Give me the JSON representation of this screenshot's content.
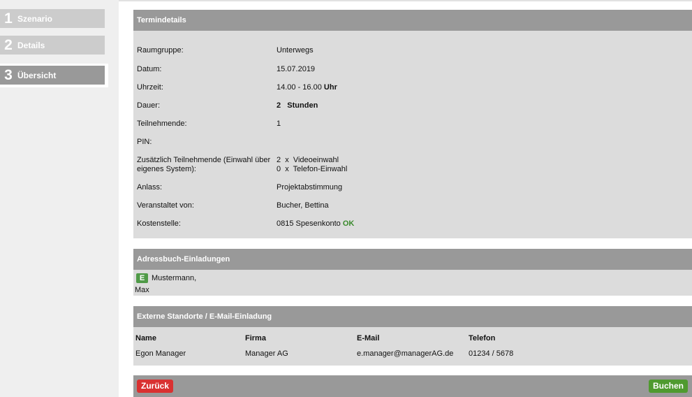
{
  "sidebar": {
    "steps": [
      {
        "num": "1",
        "label": "Szenario"
      },
      {
        "num": "2",
        "label": "Details"
      },
      {
        "num": "3",
        "label": "Übersicht"
      }
    ]
  },
  "termin": {
    "title": "Termindetails",
    "raumgruppe": {
      "label": "Raumgruppe:",
      "value": "Unterwegs"
    },
    "datum": {
      "label": "Datum:",
      "value": "15.07.2019"
    },
    "uhrzeit": {
      "label": "Uhrzeit:",
      "value": "14.00 - 16.00",
      "unit": "Uhr"
    },
    "dauer": {
      "label": "Dauer:",
      "value": "2",
      "unit": "Stunden"
    },
    "teilnehmende": {
      "label": "Teilnehmende:",
      "value": "1"
    },
    "pin": {
      "label": "PIN:",
      "value": ""
    },
    "zusaetzlich": {
      "label_line1": "Zusätzlich Teilnehmende (Einwahl über",
      "label_line2": "eigenes System):",
      "line1": "2  x  Videoeinwahl",
      "line2": "0  x  Telefon-Einwahl"
    },
    "anlass": {
      "label": "Anlass:",
      "value": "Projektabstimmung"
    },
    "veranstaltet": {
      "label": "Veranstaltet von:",
      "value": "Bucher, Bettina"
    },
    "kostenstelle": {
      "label": "Kostenstelle:",
      "value": "0815 Spesenkonto",
      "status": "OK"
    }
  },
  "adressbuch": {
    "title": "Adressbuch-Einladungen",
    "entry": {
      "badge": "E",
      "line1": "Mustermann,",
      "line2": "Max"
    }
  },
  "extern": {
    "title": "Externe Standorte / E-Mail-Einladung",
    "columns": [
      "Name",
      "Firma",
      "E-Mail",
      "Telefon"
    ],
    "rows": [
      [
        "Egon Manager",
        "Manager AG",
        "e.manager@managerAG.de",
        "01234 / 5678"
      ]
    ]
  },
  "footer": {
    "back": "Zurück",
    "book": "Buchen"
  },
  "colors": {
    "header": "#999999",
    "panel": "#dcdcdc",
    "ok": "#3a8a2c",
    "back": "#d93131",
    "book": "#4f9a2f"
  }
}
